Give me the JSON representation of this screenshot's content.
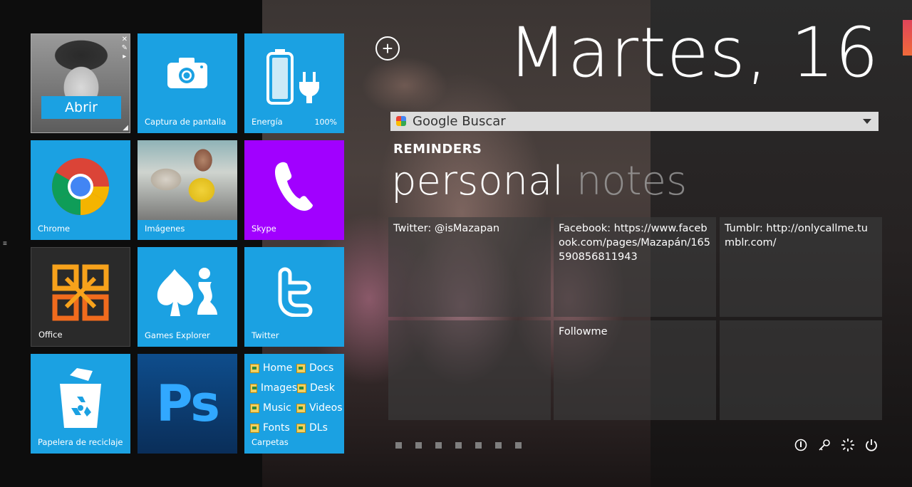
{
  "date_text": "Martes, 16",
  "add_symbol": "+",
  "tiles": {
    "user": {
      "action_label": "Abrir",
      "mini_icons": [
        "✕",
        "✎",
        "▸"
      ]
    },
    "screenshot": {
      "label": "Captura de pantalla"
    },
    "energy": {
      "label": "Energía",
      "percent": "100%",
      "battery_level": 1.0
    },
    "chrome": {
      "label": "Chrome"
    },
    "images": {
      "label": "Imágenes"
    },
    "skype": {
      "label": "Skype"
    },
    "office": {
      "label": "Office"
    },
    "games": {
      "label": "Games Explorer"
    },
    "twitter": {
      "label": "Twitter"
    },
    "recycle": {
      "label": "Papelera de reciclaje"
    },
    "photoshop": {
      "glyph": "Ps"
    },
    "folders": {
      "label": "Carpetas",
      "items": [
        "Home",
        "Docs",
        "Images",
        "Desk",
        "Music",
        "Videos",
        "Fonts",
        "DLs"
      ]
    }
  },
  "search": {
    "engine_label": "Google Buscar"
  },
  "reminders": {
    "heading": "REMINDERS",
    "pivot_active": "personal",
    "pivot_inactive": "notes",
    "notes": [
      "Twitter: @isMazapan",
      "Facebook: https://www.facebook.com/pages/Mazapán/165590856811943",
      "Tumblr: http://onlycallme.tumblr.com/",
      "",
      "Followme",
      ""
    ]
  },
  "page_dots": 7,
  "system_icons": [
    "info-icon",
    "key-icon",
    "settings-icon",
    "power-icon"
  ],
  "colors": {
    "tile_blue": "#1ba1e2",
    "skype_purple": "#a100ff",
    "accent_edge": "#e0455a"
  }
}
